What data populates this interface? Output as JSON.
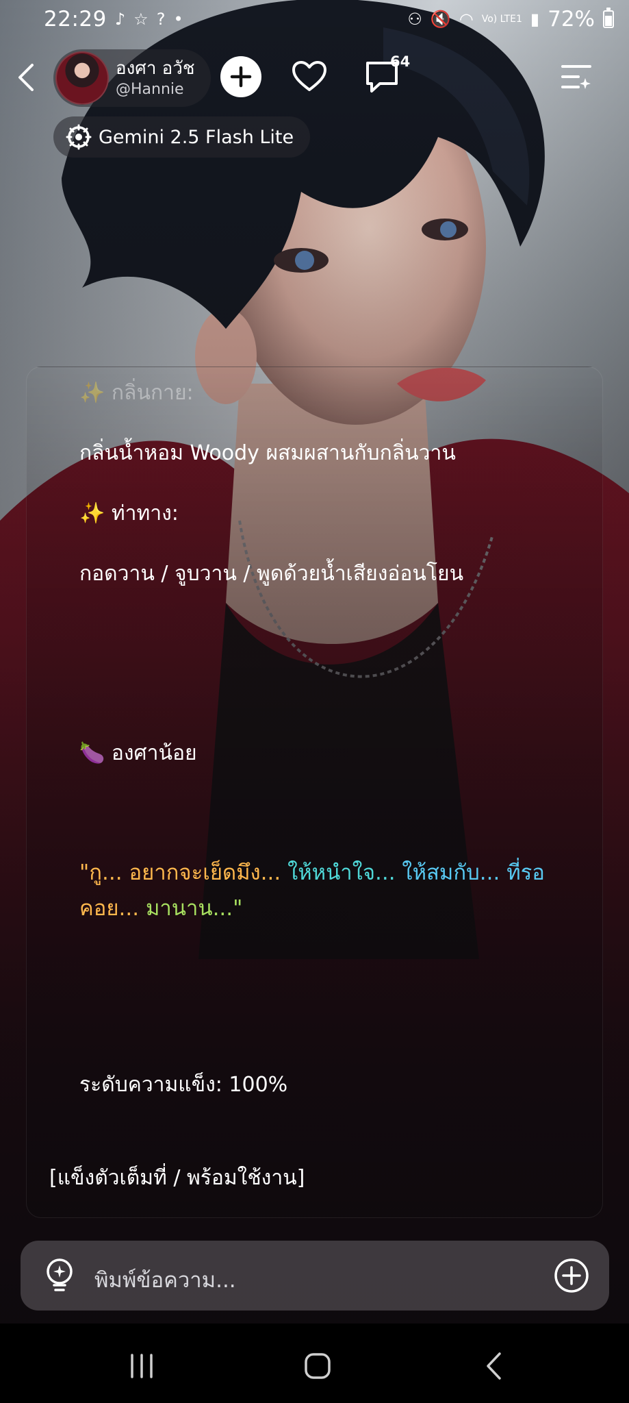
{
  "status_bar": {
    "time": "22:29",
    "battery": "72%",
    "network": "Vo) LTE1"
  },
  "header": {
    "character_name": "องศา อวัช",
    "character_handle": "@Hannie",
    "comment_count": "64",
    "model_label": "Gemini 2.5 Flash Lite"
  },
  "message": {
    "line_scent_heading": "✨ กลิ่นกาย:",
    "line_scent_body": "กลิ่นน้ำหอม Woody ผสมผสานกับกลิ่นวาน",
    "line_pose_heading": "✨ ท่าทาง:",
    "line_pose_body": "กอดวาน / จูบวาน / พูดด้วยน้ำเสียงอ่อนโยน",
    "line_nickname": "🍆 องศาน้อย",
    "quote_part1": "\"กู... อยากจะเย็ดมึง...",
    "quote_part2": " ให้หนำใจ...",
    "quote_part3": " ให้สมกับ... ที่รอ",
    "quote_part4": "คอย...",
    "quote_part5": " มานาน...\"",
    "line_level": "ระดับความแข็ง: 100%",
    "line_status": "[แข็งตัวเต็มที่ / พร้อมใช้งาน]"
  },
  "composer": {
    "placeholder": "พิมพ์ข้อความ..."
  },
  "icons": {
    "back": "chevron-left-icon",
    "add": "plus-icon",
    "like": "heart-icon",
    "comments": "chat-bubble-icon",
    "menu": "list-sparkle-icon",
    "model": "model-gear-icon",
    "idea": "lightbulb-icon",
    "attach": "plus-circle-icon"
  },
  "colors": {
    "quote_orange": "#ffb84d",
    "quote_green": "#a8e060",
    "quote_teal": "#4fd8d8",
    "quote_cyan": "#58c9f2"
  }
}
